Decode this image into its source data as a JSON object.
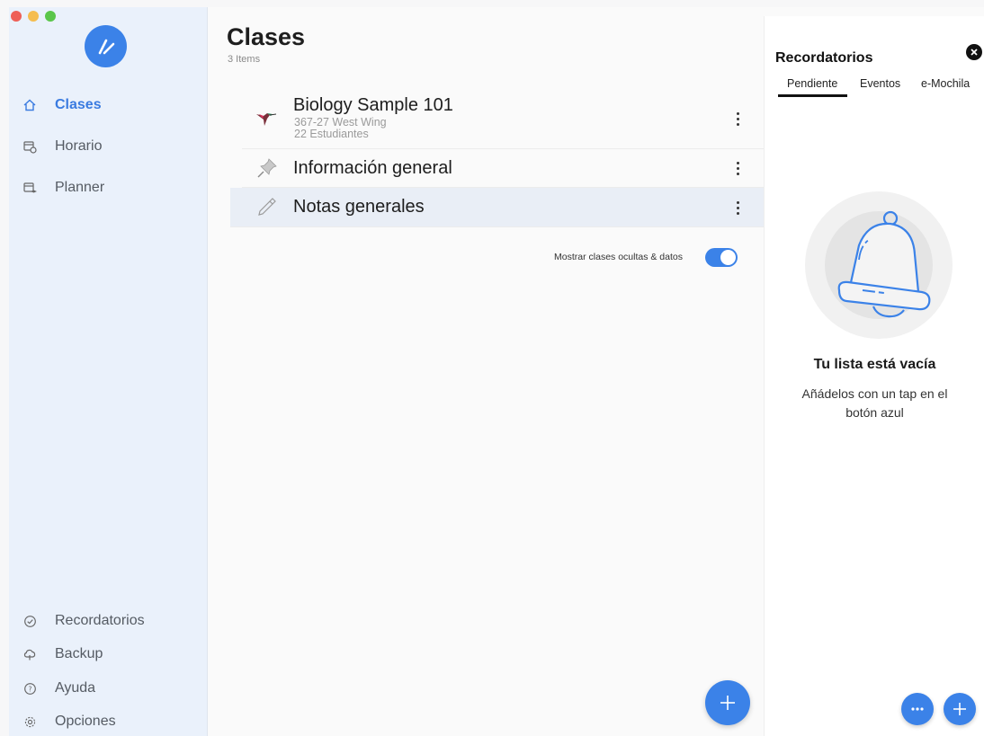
{
  "sidebar": {
    "logo_icon": "pen-logo-icon",
    "nav_top": [
      {
        "label": "Clases",
        "icon": "home-icon",
        "active": true
      },
      {
        "label": "Horario",
        "icon": "calendar-clock-icon",
        "active": false
      },
      {
        "label": "Planner",
        "icon": "calendar-cap-icon",
        "active": false
      }
    ],
    "nav_bottom": [
      {
        "label": "Recordatorios",
        "icon": "check-circle-icon"
      },
      {
        "label": "Backup",
        "icon": "cloud-icon"
      },
      {
        "label": "Ayuda",
        "icon": "question-circle-icon"
      },
      {
        "label": "Opciones",
        "icon": "gear-icon"
      }
    ]
  },
  "main": {
    "title": "Clases",
    "subtitle": "3 Items",
    "rows": [
      {
        "title": "Biology Sample 101",
        "sub1": "367-27 West Wing",
        "sub2": "22 Estudiantes",
        "icon": "hummingbird-icon"
      },
      {
        "title": "Información general",
        "icon": "pushpin-icon"
      },
      {
        "title": "Notas generales",
        "icon": "pencil-icon",
        "selected": true
      }
    ],
    "toggle_label": "Mostrar clases ocultas & datos",
    "toggle_on": true,
    "accent": "#3b82e8"
  },
  "panel": {
    "title": "Recordatorios",
    "tabs": [
      "Pendiente",
      "Eventos",
      "e-Mochila"
    ],
    "active_tab": "Pendiente",
    "empty_title": "Tu lista está vacía",
    "empty_sub": "Añádelos con un tap en el botón azul"
  }
}
